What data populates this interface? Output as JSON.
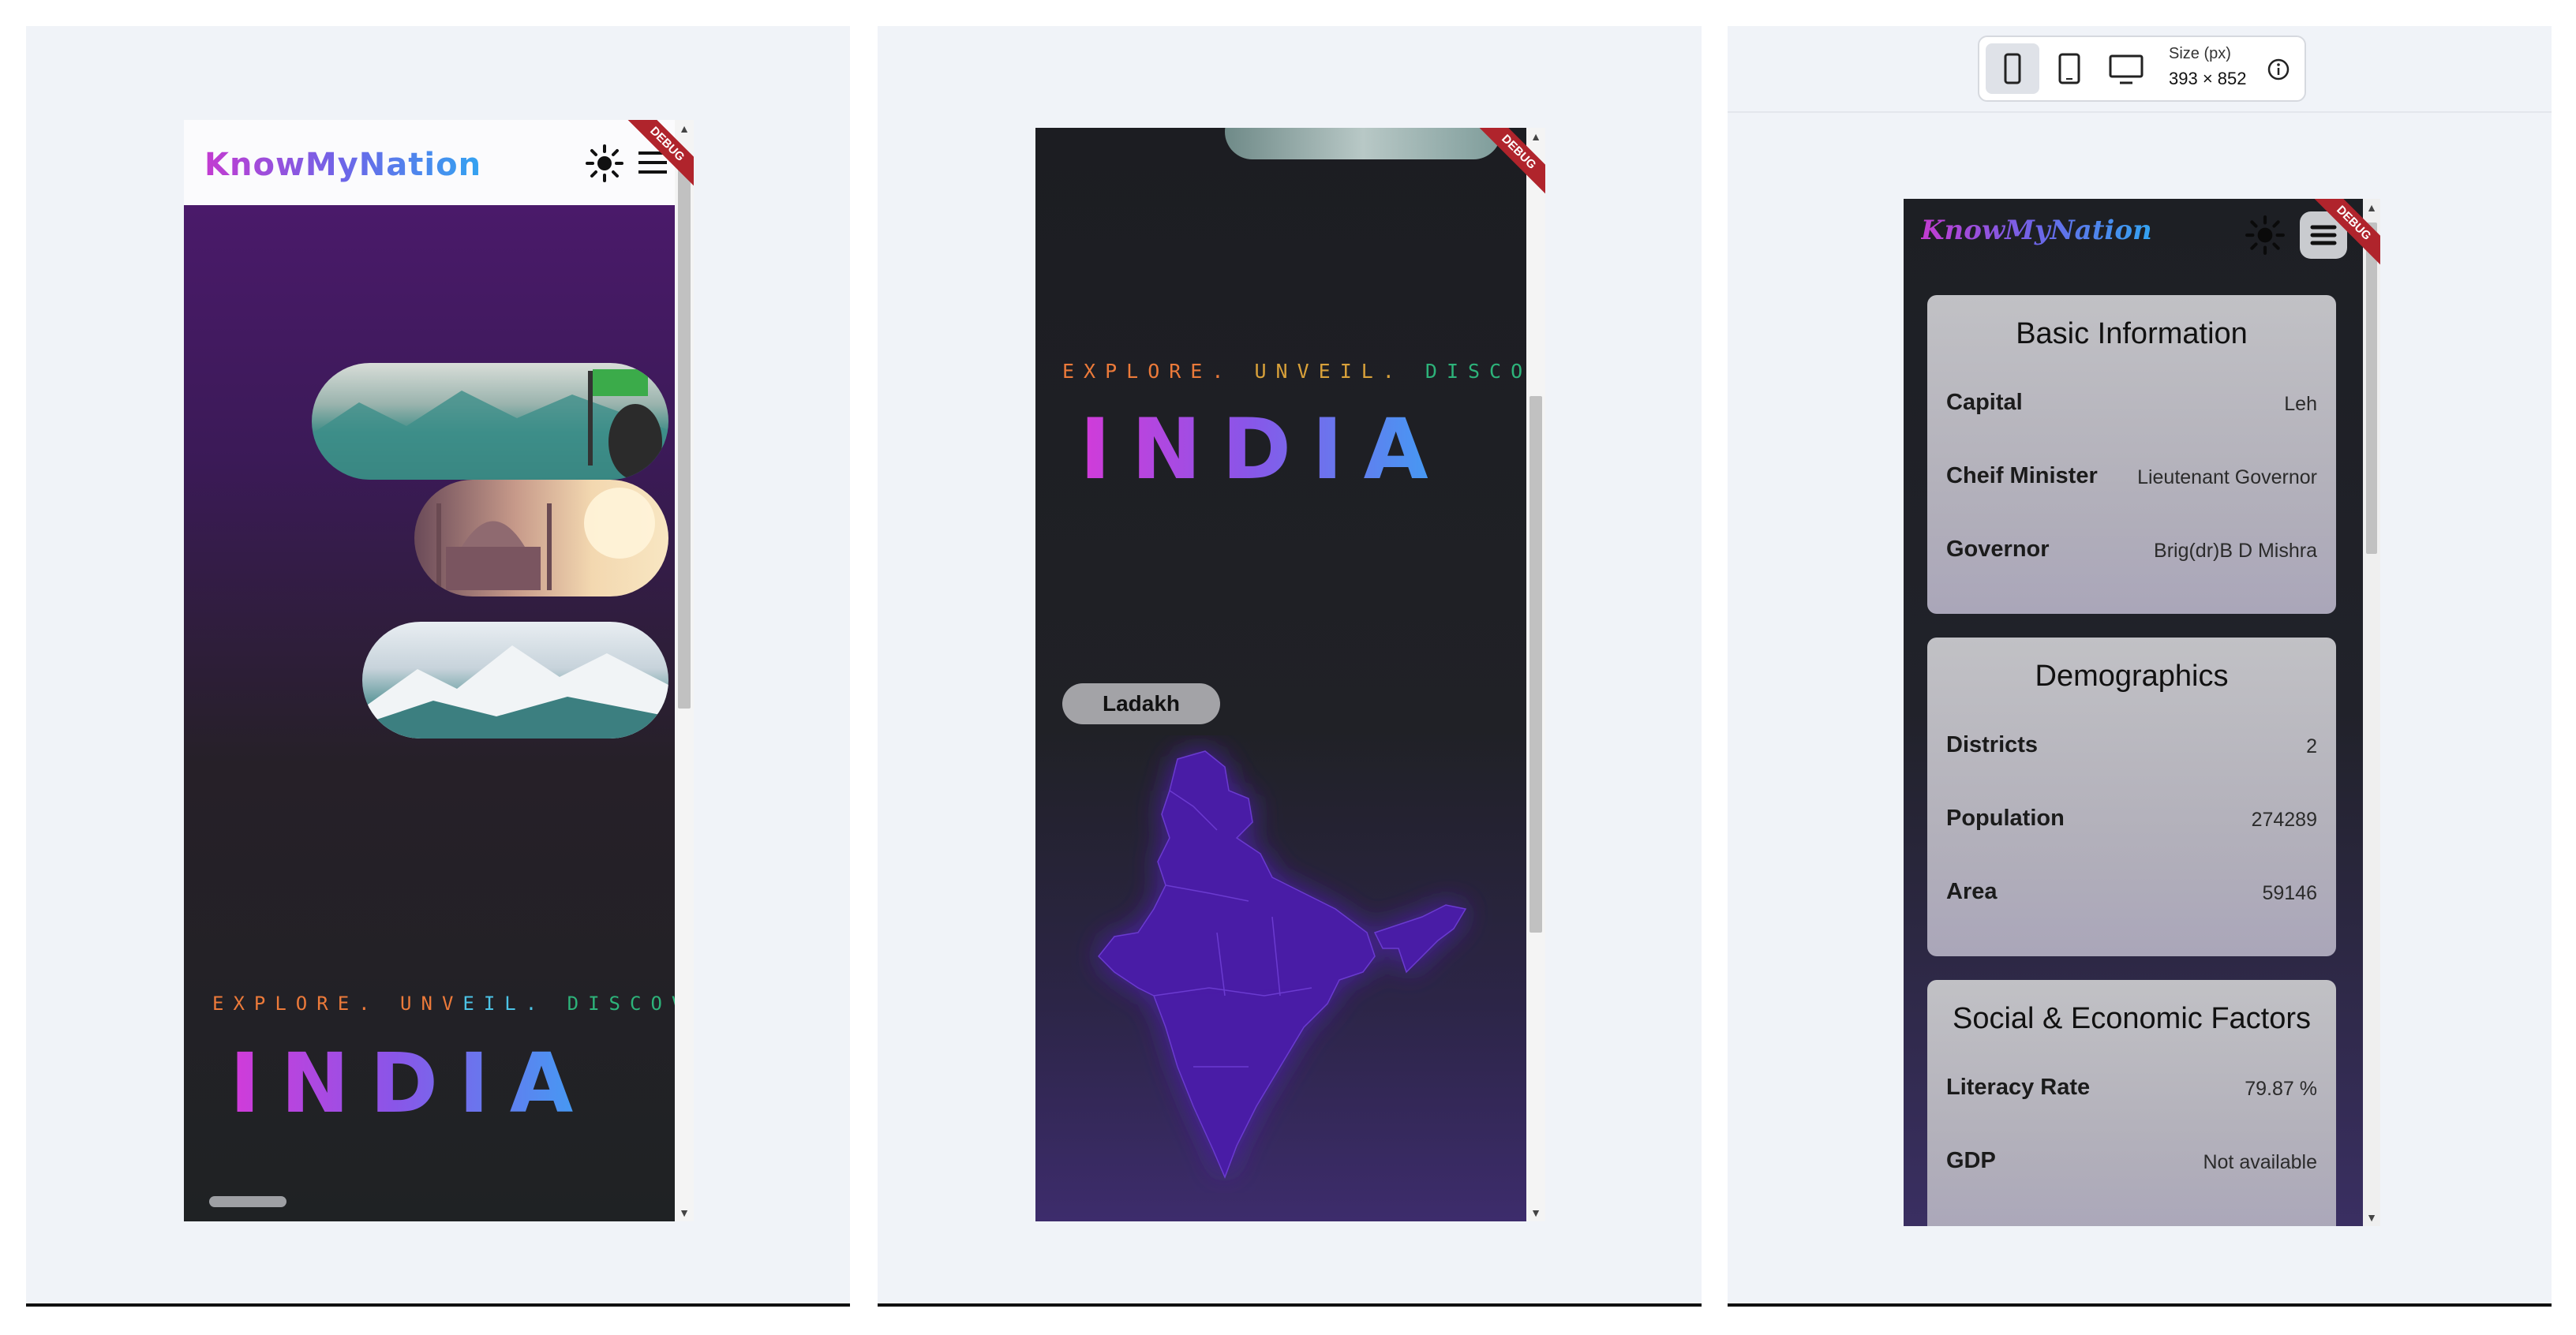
{
  "screen1": {
    "app_title": "KnowMyNation",
    "tagline": {
      "part1": "EXPLORE.",
      "part2a": "UNV",
      "part2b": "EIL.",
      "part3": "DISCOVER."
    },
    "hero_title": "INDIA",
    "debug_banner": "DEBUG"
  },
  "screen2": {
    "tagline": {
      "part1": "EXPLORE.",
      "part2": "UNVEIL.",
      "part3": "DISCOVER."
    },
    "hero_title": "INDIA",
    "region_chip": "Ladakh",
    "debug_banner": "DEBUG"
  },
  "toolbar": {
    "size_label": "Size (px)",
    "size_value": "393 × 852"
  },
  "screen3": {
    "app_title": "KnowMyNation",
    "debug_banner": "DEBUG",
    "cards": {
      "basic": {
        "title": "Basic Information",
        "rows": [
          {
            "key": "Capital",
            "value": "Leh"
          },
          {
            "key": "Cheif Minister",
            "value": "Lieutenant Governor"
          },
          {
            "key": "Governor",
            "value": "Brig(dr)B D Mishra"
          }
        ]
      },
      "demographics": {
        "title": "Demographics",
        "rows": [
          {
            "key": "Districts",
            "value": "2"
          },
          {
            "key": "Population",
            "value": "274289"
          },
          {
            "key": "Area",
            "value": "59146"
          }
        ]
      },
      "social": {
        "title": "Social & Economic Factors",
        "rows": [
          {
            "key": "Literacy Rate",
            "value": "79.87 %"
          },
          {
            "key": "GDP",
            "value": "Not available"
          }
        ]
      }
    }
  },
  "colors": {
    "accent_purple": "#d23bd9",
    "accent_blue": "#3fa0f4",
    "map_fill": "#4a1aa6",
    "debug_red": "#b0242c"
  }
}
